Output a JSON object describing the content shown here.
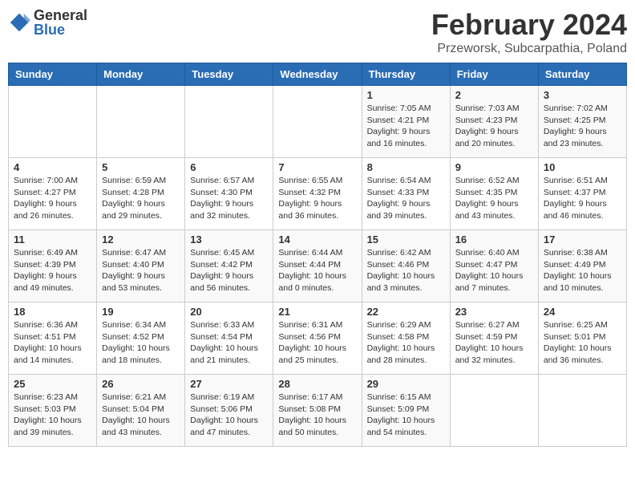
{
  "logo": {
    "general": "General",
    "blue": "Blue"
  },
  "title": "February 2024",
  "subtitle": "Przeworsk, Subcarpathia, Poland",
  "weekdays": [
    "Sunday",
    "Monday",
    "Tuesday",
    "Wednesday",
    "Thursday",
    "Friday",
    "Saturday"
  ],
  "weeks": [
    [
      {
        "day": "",
        "info": ""
      },
      {
        "day": "",
        "info": ""
      },
      {
        "day": "",
        "info": ""
      },
      {
        "day": "",
        "info": ""
      },
      {
        "day": "1",
        "info": "Sunrise: 7:05 AM\nSunset: 4:21 PM\nDaylight: 9 hours and 16 minutes."
      },
      {
        "day": "2",
        "info": "Sunrise: 7:03 AM\nSunset: 4:23 PM\nDaylight: 9 hours and 20 minutes."
      },
      {
        "day": "3",
        "info": "Sunrise: 7:02 AM\nSunset: 4:25 PM\nDaylight: 9 hours and 23 minutes."
      }
    ],
    [
      {
        "day": "4",
        "info": "Sunrise: 7:00 AM\nSunset: 4:27 PM\nDaylight: 9 hours and 26 minutes."
      },
      {
        "day": "5",
        "info": "Sunrise: 6:59 AM\nSunset: 4:28 PM\nDaylight: 9 hours and 29 minutes."
      },
      {
        "day": "6",
        "info": "Sunrise: 6:57 AM\nSunset: 4:30 PM\nDaylight: 9 hours and 32 minutes."
      },
      {
        "day": "7",
        "info": "Sunrise: 6:55 AM\nSunset: 4:32 PM\nDaylight: 9 hours and 36 minutes."
      },
      {
        "day": "8",
        "info": "Sunrise: 6:54 AM\nSunset: 4:33 PM\nDaylight: 9 hours and 39 minutes."
      },
      {
        "day": "9",
        "info": "Sunrise: 6:52 AM\nSunset: 4:35 PM\nDaylight: 9 hours and 43 minutes."
      },
      {
        "day": "10",
        "info": "Sunrise: 6:51 AM\nSunset: 4:37 PM\nDaylight: 9 hours and 46 minutes."
      }
    ],
    [
      {
        "day": "11",
        "info": "Sunrise: 6:49 AM\nSunset: 4:39 PM\nDaylight: 9 hours and 49 minutes."
      },
      {
        "day": "12",
        "info": "Sunrise: 6:47 AM\nSunset: 4:40 PM\nDaylight: 9 hours and 53 minutes."
      },
      {
        "day": "13",
        "info": "Sunrise: 6:45 AM\nSunset: 4:42 PM\nDaylight: 9 hours and 56 minutes."
      },
      {
        "day": "14",
        "info": "Sunrise: 6:44 AM\nSunset: 4:44 PM\nDaylight: 10 hours and 0 minutes."
      },
      {
        "day": "15",
        "info": "Sunrise: 6:42 AM\nSunset: 4:46 PM\nDaylight: 10 hours and 3 minutes."
      },
      {
        "day": "16",
        "info": "Sunrise: 6:40 AM\nSunset: 4:47 PM\nDaylight: 10 hours and 7 minutes."
      },
      {
        "day": "17",
        "info": "Sunrise: 6:38 AM\nSunset: 4:49 PM\nDaylight: 10 hours and 10 minutes."
      }
    ],
    [
      {
        "day": "18",
        "info": "Sunrise: 6:36 AM\nSunset: 4:51 PM\nDaylight: 10 hours and 14 minutes."
      },
      {
        "day": "19",
        "info": "Sunrise: 6:34 AM\nSunset: 4:52 PM\nDaylight: 10 hours and 18 minutes."
      },
      {
        "day": "20",
        "info": "Sunrise: 6:33 AM\nSunset: 4:54 PM\nDaylight: 10 hours and 21 minutes."
      },
      {
        "day": "21",
        "info": "Sunrise: 6:31 AM\nSunset: 4:56 PM\nDaylight: 10 hours and 25 minutes."
      },
      {
        "day": "22",
        "info": "Sunrise: 6:29 AM\nSunset: 4:58 PM\nDaylight: 10 hours and 28 minutes."
      },
      {
        "day": "23",
        "info": "Sunrise: 6:27 AM\nSunset: 4:59 PM\nDaylight: 10 hours and 32 minutes."
      },
      {
        "day": "24",
        "info": "Sunrise: 6:25 AM\nSunset: 5:01 PM\nDaylight: 10 hours and 36 minutes."
      }
    ],
    [
      {
        "day": "25",
        "info": "Sunrise: 6:23 AM\nSunset: 5:03 PM\nDaylight: 10 hours and 39 minutes."
      },
      {
        "day": "26",
        "info": "Sunrise: 6:21 AM\nSunset: 5:04 PM\nDaylight: 10 hours and 43 minutes."
      },
      {
        "day": "27",
        "info": "Sunrise: 6:19 AM\nSunset: 5:06 PM\nDaylight: 10 hours and 47 minutes."
      },
      {
        "day": "28",
        "info": "Sunrise: 6:17 AM\nSunset: 5:08 PM\nDaylight: 10 hours and 50 minutes."
      },
      {
        "day": "29",
        "info": "Sunrise: 6:15 AM\nSunset: 5:09 PM\nDaylight: 10 hours and 54 minutes."
      },
      {
        "day": "",
        "info": ""
      },
      {
        "day": "",
        "info": ""
      }
    ]
  ]
}
